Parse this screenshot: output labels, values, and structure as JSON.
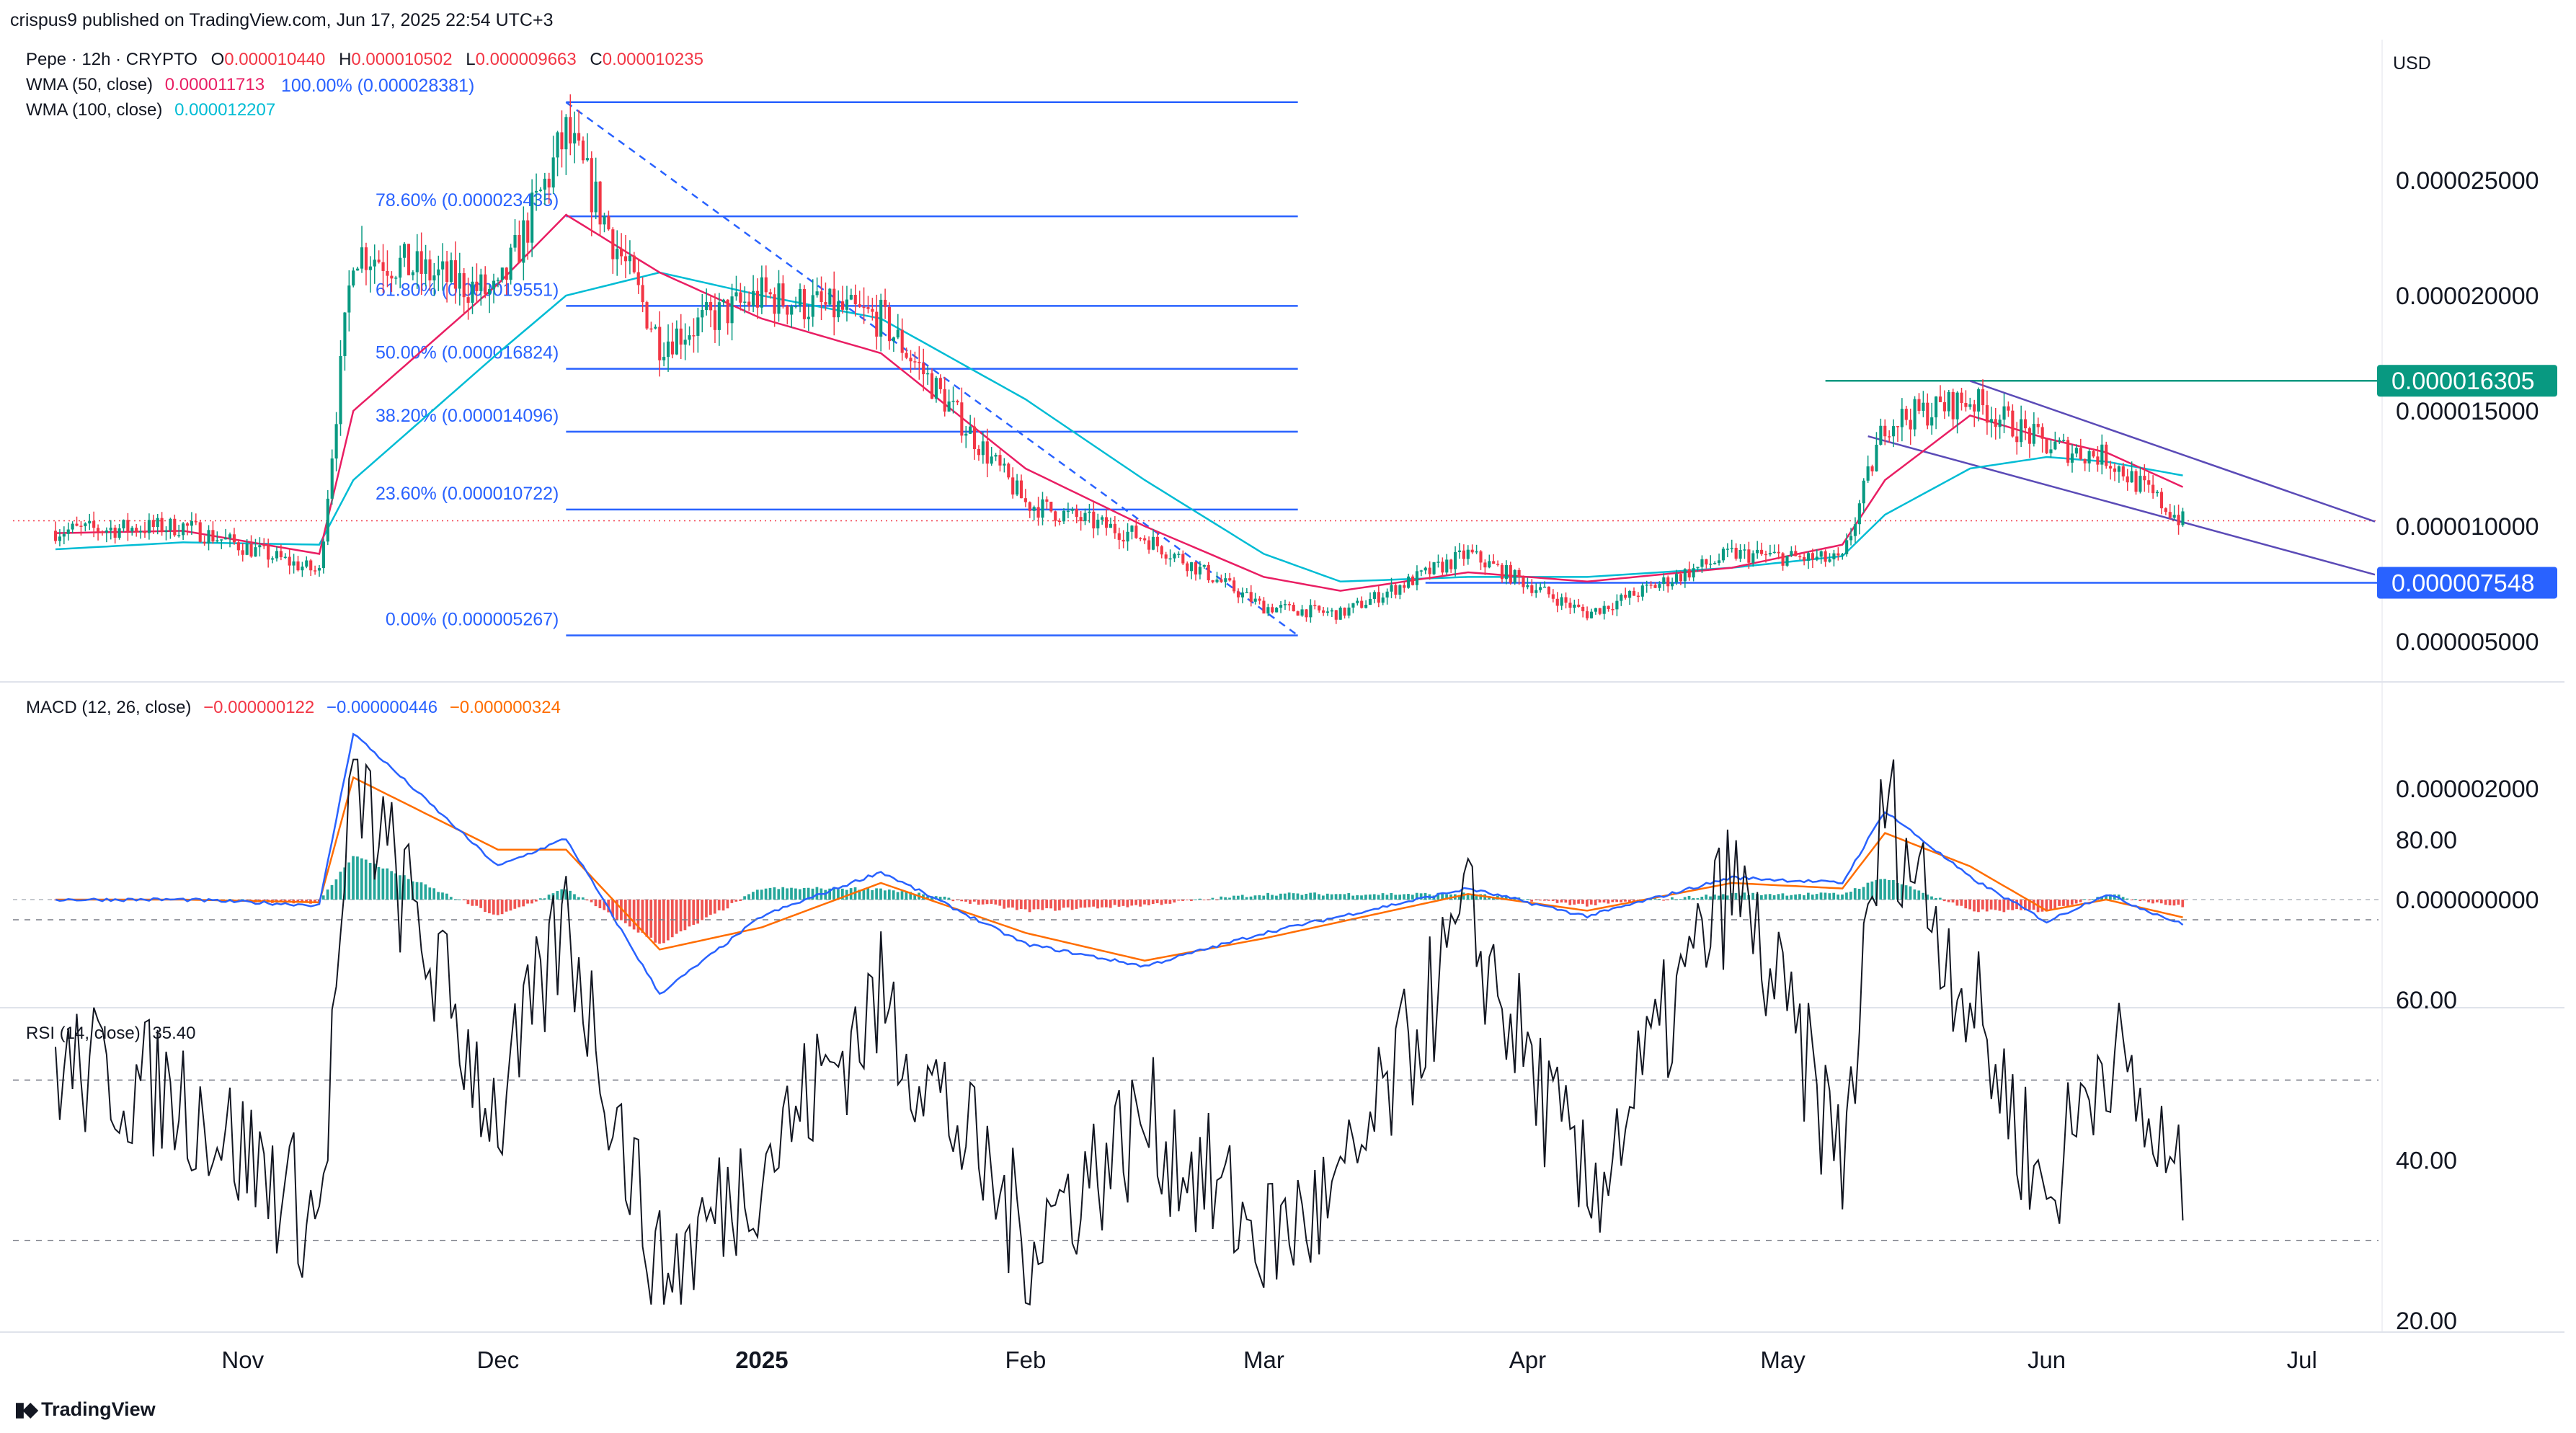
{
  "publisher_line": "crispus9 published on TradingView.com, Jun 17, 2025 22:54 UTC+3",
  "symbol": {
    "name": "Pepe · 12h · CRYPTO",
    "o_label": "O",
    "o": "0.000010440",
    "h_label": "H",
    "h": "0.000010502",
    "l_label": "L",
    "l": "0.000009663",
    "c_label": "C",
    "c": "0.000010235"
  },
  "currency": "USD",
  "wma50": {
    "label": "WMA (50, close)",
    "value": "0.000011713",
    "color": "#e91e63"
  },
  "wma100": {
    "label": "WMA (100, close)",
    "value": "0.000012207",
    "color": "#00bcd4"
  },
  "fib_levels": [
    {
      "label": "100.00% (0.000028381)",
      "value": 2.8381e-05
    },
    {
      "label": "78.60% (0.000023435)",
      "value": 2.3435e-05
    },
    {
      "label": "61.80% (0.000019551)",
      "value": 1.9551e-05
    },
    {
      "label": "50.00% (0.000016824)",
      "value": 1.6824e-05
    },
    {
      "label": "38.20% (0.000014096)",
      "value": 1.4096e-05
    },
    {
      "label": "23.60% (0.000010722)",
      "value": 1.0722e-05
    },
    {
      "label": "0.00% (0.000005267)",
      "value": 5.267e-06
    }
  ],
  "badges": {
    "resistance": {
      "text": "0.000016305",
      "value": 1.6305e-05,
      "color": "#089981"
    },
    "support": {
      "text": "0.000007548",
      "value": 7.548e-06,
      "color": "#2962ff"
    }
  },
  "price_ticks": [
    "0.000025000",
    "0.000020000",
    "0.000015000",
    "0.000010000",
    "0.000005000"
  ],
  "macd": {
    "label": "MACD (12, 26, close)",
    "hist": "−0.000000122",
    "macd": "−0.000000446",
    "signal": "−0.000000324",
    "ticks": [
      "0.000002000",
      "0.000000000"
    ]
  },
  "rsi": {
    "label": "RSI (14, close)",
    "value": "35.40",
    "ticks": [
      "80.00",
      "60.00",
      "40.00",
      "20.00"
    ]
  },
  "x_ticks": [
    "Nov",
    "Dec",
    "2025",
    "Feb",
    "Mar",
    "Apr",
    "May",
    "Jun",
    "Jul"
  ],
  "footer": "TradingView",
  "chart_data": {
    "type": "line",
    "x": [
      "2024-10-10",
      "2024-10-25",
      "2024-11-10",
      "2024-11-14",
      "2024-12-01",
      "2024-12-09",
      "2024-12-20",
      "2025-01-01",
      "2025-01-15",
      "2025-02-01",
      "2025-02-15",
      "2025-03-01",
      "2025-03-10",
      "2025-03-25",
      "2025-04-08",
      "2025-04-25",
      "2025-05-08",
      "2025-05-13",
      "2025-05-23",
      "2025-06-01",
      "2025-06-08",
      "2025-06-17"
    ],
    "series": [
      {
        "name": "Pepe · 12h · CRYPTO",
        "values": [
          9.8e-06,
          1e-05,
          8e-06,
          2.2e-05,
          2e-05,
          2.7e-05,
          1.8e-05,
          2e-05,
          1.9e-05,
          1.1e-05,
          9.5e-06,
          6.5e-06,
          6.2e-06,
          8.8e-06,
          6.2e-06,
          8.8e-06,
          8.5e-06,
          1.45e-05,
          1.55e-05,
          1.35e-05,
          1.3e-05,
          1.02e-05
        ]
      },
      {
        "name": "WMA (50, close)",
        "values": [
          9.7e-06,
          9.8e-06,
          8.8e-06,
          1.5e-05,
          2.05e-05,
          2.35e-05,
          2.1e-05,
          1.9e-05,
          1.75e-05,
          1.25e-05,
          1e-05,
          7.8e-06,
          7.2e-06,
          8e-06,
          7.6e-06,
          8.2e-06,
          9.2e-06,
          1.2e-05,
          1.48e-05,
          1.38e-05,
          1.32e-05,
          1.17e-05
        ]
      },
      {
        "name": "WMA (100, close)",
        "values": [
          9e-06,
          9.3e-06,
          9.2e-06,
          1.2e-05,
          1.75e-05,
          2e-05,
          2.1e-05,
          2e-05,
          1.9e-05,
          1.55e-05,
          1.2e-05,
          8.8e-06,
          7.6e-06,
          7.8e-06,
          7.8e-06,
          8.2e-06,
          8.7e-06,
          1.05e-05,
          1.25e-05,
          1.3e-05,
          1.28e-05,
          1.22e-05
        ]
      }
    ],
    "ylim": [
      3.5e-06,
      2.9e-05
    ]
  }
}
